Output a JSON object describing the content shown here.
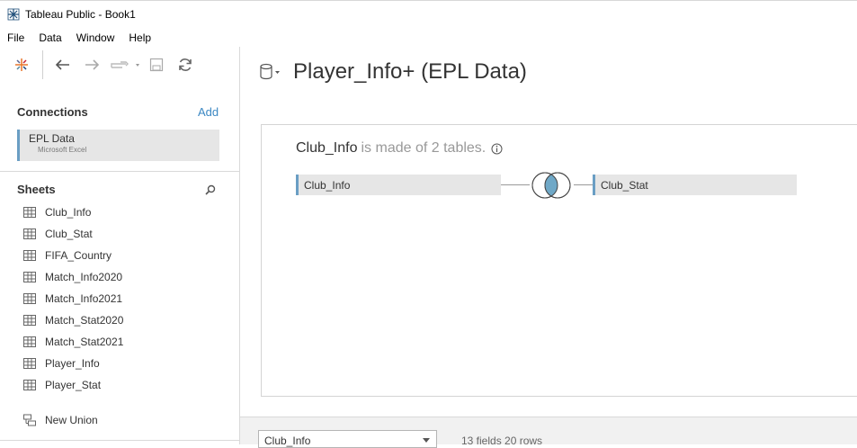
{
  "window": {
    "title": "Tableau Public - Book1"
  },
  "menu": [
    "File",
    "Data",
    "Window",
    "Help"
  ],
  "toolbar": {
    "icons": [
      "tableau-logo-icon",
      "back-arrow-icon",
      "forward-arrow-icon",
      "redo-icon",
      "save-icon",
      "refresh-icon"
    ]
  },
  "connections": {
    "title": "Connections",
    "add_label": "Add",
    "items": [
      {
        "name": "EPL Data",
        "type": "Microsoft Excel"
      }
    ]
  },
  "sheets": {
    "title": "Sheets",
    "items": [
      "Club_Info",
      "Club_Stat",
      "FIFA_Country",
      "Match_Info2020",
      "Match_Info2021",
      "Match_Stat2020",
      "Match_Stat2021",
      "Player_Info",
      "Player_Stat"
    ],
    "new_union_label": "New Union"
  },
  "datasource": {
    "title": "Player_Info+ (EPL Data)"
  },
  "model": {
    "table_name": "Club_Info",
    "description": "is made of 2 tables.",
    "left_table": "Club_Info",
    "right_table": "Club_Stat",
    "join_type": "inner"
  },
  "bottom": {
    "selected_table": "Club_Info",
    "fields_info": "13 fields 20 rows"
  },
  "colors": {
    "accent": "#6a9ec4",
    "link": "#3c88c3",
    "venn_fill": "#6fa8c7"
  }
}
